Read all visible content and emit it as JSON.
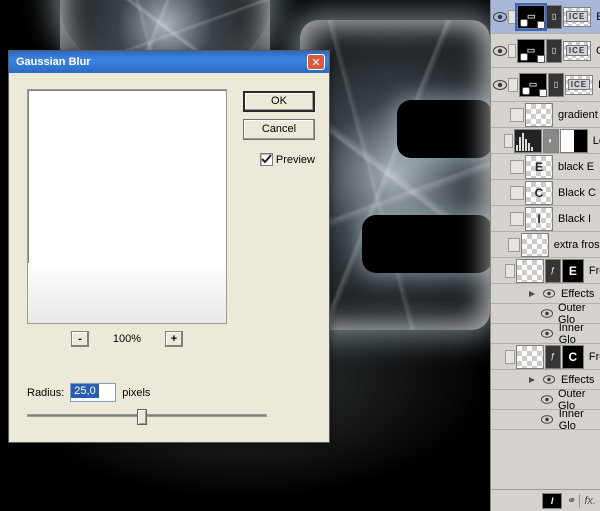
{
  "dialog": {
    "title": "Gaussian Blur",
    "ok": "OK",
    "cancel": "Cancel",
    "preview_label": "Preview",
    "zoom_out": "-",
    "zoom_in": "+",
    "zoom_level": "100%",
    "radius_label": "Radius:",
    "radius_value": "25,0",
    "radius_unit": "pixels"
  },
  "layers": {
    "items": [
      {
        "label": "E",
        "thumb_text": "ICE",
        "big_letter": ""
      },
      {
        "label": "C",
        "thumb_text": "ICE"
      },
      {
        "label": "I",
        "thumb_text": "ICE"
      }
    ],
    "gradient": "gradient",
    "levels": "Le",
    "black_e": {
      "glyph": "E",
      "label": "black E"
    },
    "black_c": {
      "glyph": "C",
      "label": "Black C"
    },
    "black_i": {
      "glyph": "I",
      "label": "Black I"
    },
    "extra": "extra frosty",
    "frosty_e": {
      "glyph": "E",
      "label": "Fro"
    },
    "frosty_c": {
      "glyph": "C",
      "label": "Fro"
    },
    "effects": "Effects",
    "outer_glow": "Outer Glo",
    "inner_glow": "Inner Glo",
    "footer_fx": "fx."
  }
}
